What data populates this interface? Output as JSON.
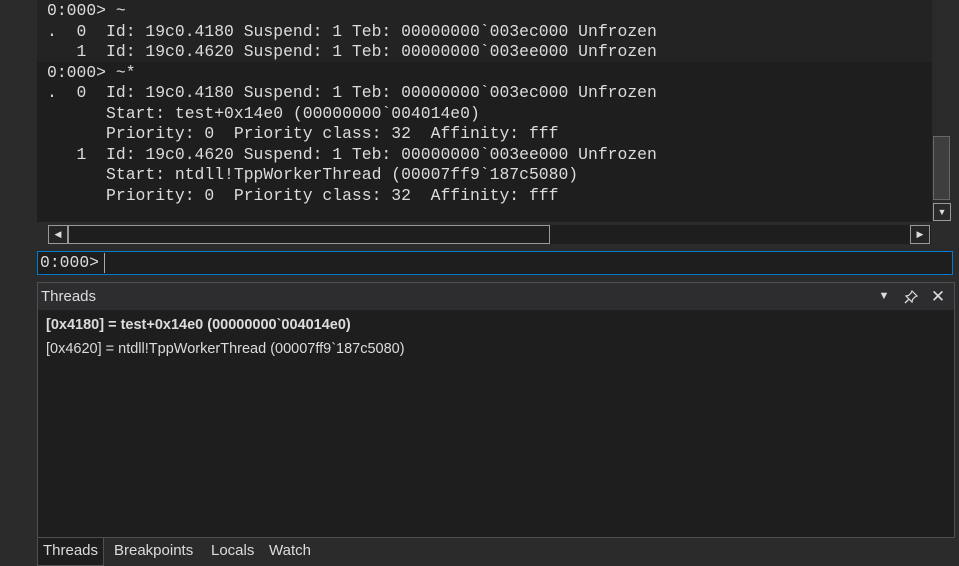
{
  "command_output": {
    "lines": [
      "0:000> ~",
      ".  0  Id: 19c0.4180 Suspend: 1 Teb: 00000000`003ec000 Unfrozen",
      "   1  Id: 19c0.4620 Suspend: 1 Teb: 00000000`003ee000 Unfrozen",
      "0:000> ~*",
      ".  0  Id: 19c0.4180 Suspend: 1 Teb: 00000000`003ec000 Unfrozen",
      "      Start: test+0x14e0 (00000000`004014e0)",
      "      Priority: 0  Priority class: 32  Affinity: fff",
      "   1  Id: 19c0.4620 Suspend: 1 Teb: 00000000`003ee000 Unfrozen",
      "      Start: ntdll!TppWorkerThread (00007ff9`187c5080)",
      "      Priority: 0  Priority class: 32  Affinity: fff"
    ]
  },
  "command_input": {
    "prompt": "0:000>",
    "value": ""
  },
  "threads_panel": {
    "title": "Threads",
    "items": [
      {
        "text": "[0x4180] = test+0x14e0 (00000000`004014e0)",
        "current": true
      },
      {
        "text": "[0x4620] = ntdll!TppWorkerThread (00007ff9`187c5080)",
        "current": false
      }
    ],
    "icons": {
      "dropdown": "chevron-down-icon",
      "pin": "pin-icon",
      "close": "close-icon"
    }
  },
  "bottom_tabs": [
    {
      "label": "Threads",
      "active": true
    },
    {
      "label": "Breakpoints",
      "active": false
    },
    {
      "label": "Locals",
      "active": false
    },
    {
      "label": "Watch",
      "active": false
    }
  ],
  "scrollbar_icons": {
    "up": "scroll-down-arrow-icon",
    "left": "scroll-left-arrow-icon",
    "right": "scroll-right-arrow-icon"
  },
  "colors": {
    "background": "#1e1e1e",
    "focus_border": "#007acc",
    "text": "#dcdcdc"
  }
}
